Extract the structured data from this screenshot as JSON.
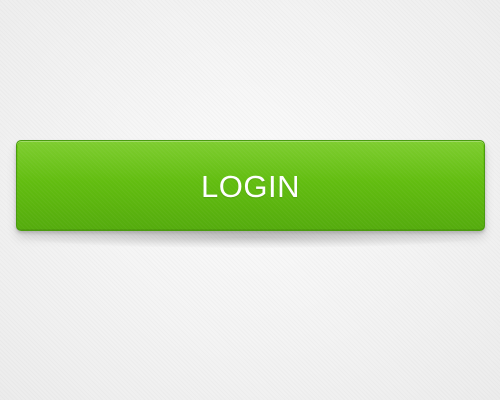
{
  "login_button": {
    "label": "LOGIN",
    "background_color": "#62bd10",
    "text_color": "#ffffff"
  }
}
